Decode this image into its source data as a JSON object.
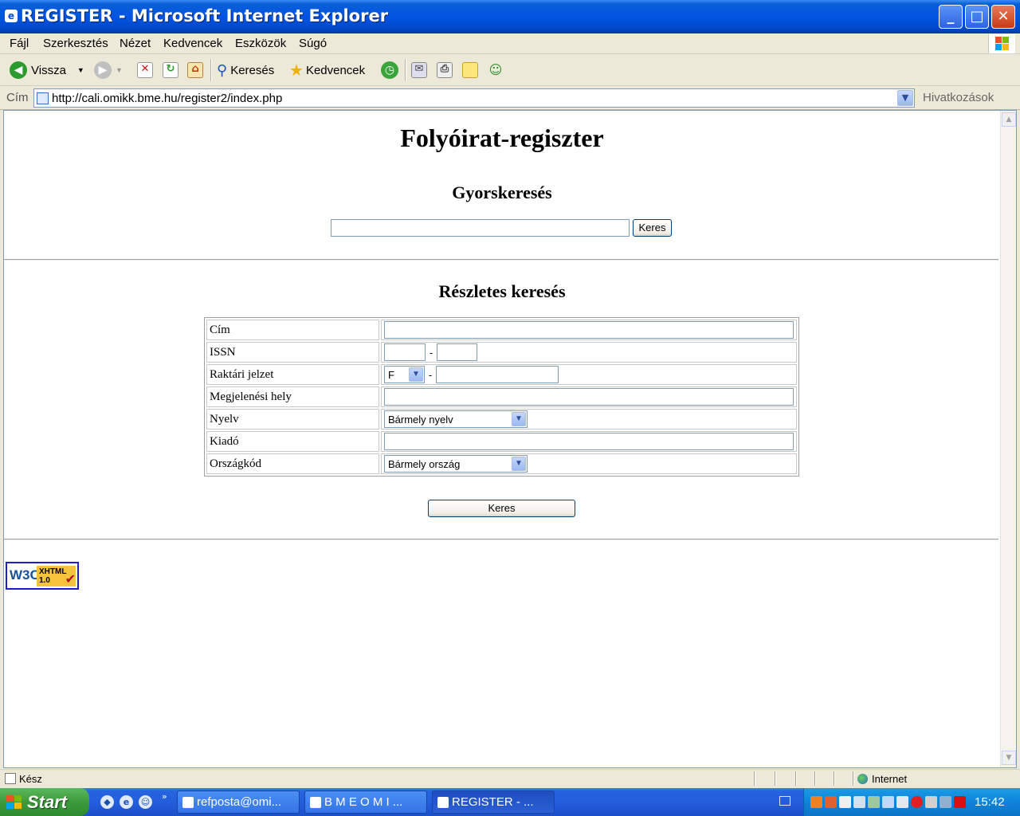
{
  "window": {
    "title": "REGISTER - Microsoft Internet Explorer",
    "minimize": "_",
    "maximize": "□",
    "close": "✕"
  },
  "menu": [
    "Fájl",
    "Szerkesztés",
    "Nézet",
    "Kedvencek",
    "Eszközök",
    "Súgó"
  ],
  "toolbar": {
    "back_label": "Vissza",
    "search_label": "Keresés",
    "favorites_label": "Kedvencek"
  },
  "address": {
    "label": "Cím",
    "url": "http://cali.omikk.bme.hu/register2/index.php",
    "links_label": "Hivatkozások"
  },
  "page": {
    "title": "Folyóirat-regiszter",
    "quick_search": {
      "heading": "Gyorskeresés",
      "value": "",
      "button": "Keres"
    },
    "detailed_search": {
      "heading": "Részletes keresés",
      "fields": {
        "title_label": "Cím",
        "issn_label": "ISSN",
        "issn_sep": "-",
        "shelf_label": "Raktári jelzet",
        "shelf_prefix": "F",
        "shelf_sep": "-",
        "place_label": "Megjelenési hely",
        "language_label": "Nyelv",
        "language_value": "Bármely nyelv",
        "publisher_label": "Kiadó",
        "country_label": "Országkód",
        "country_value": "Bármely ország"
      },
      "button": "Keres"
    },
    "badge": {
      "w3c": "W3C",
      "xhtml": "XHTML",
      "version": "1.0"
    }
  },
  "status": {
    "text": "Kész",
    "zone": "Internet"
  },
  "taskbar": {
    "start": "Start",
    "tasks": [
      "refposta@omi...",
      "B M E  O M I ...",
      "REGISTER - ..."
    ],
    "clock": "15:42"
  }
}
